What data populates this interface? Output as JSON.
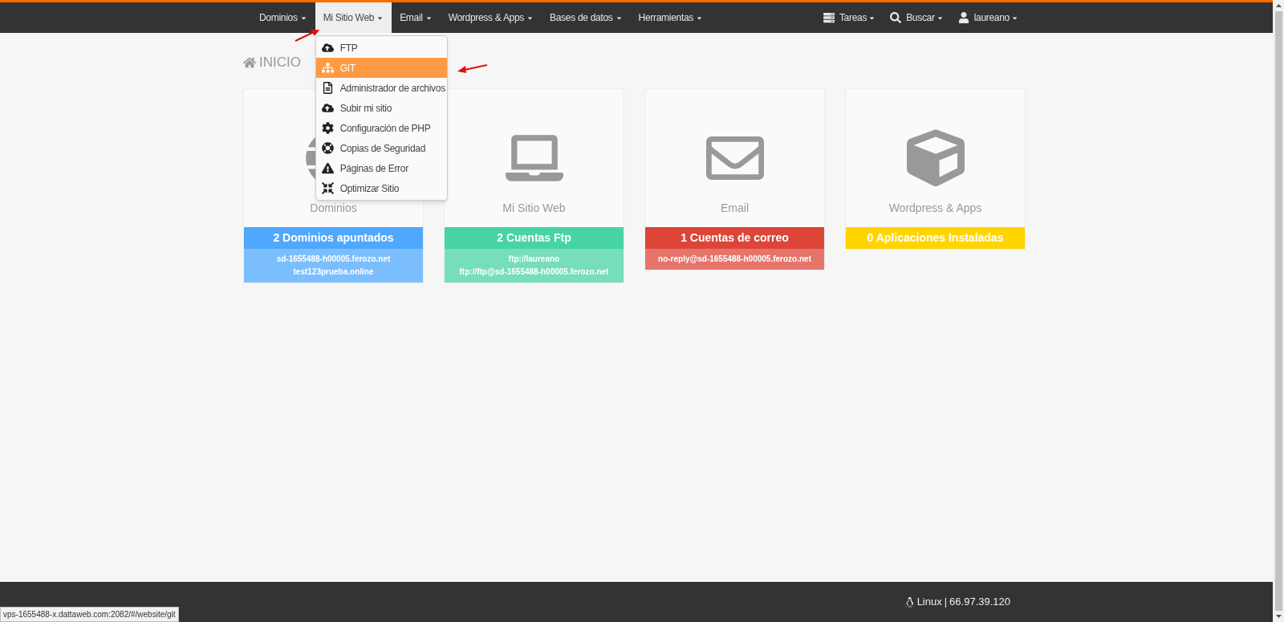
{
  "nav": {
    "items": [
      {
        "label": "Dominios",
        "selected": false
      },
      {
        "label": "Mi Sitio Web",
        "selected": true
      },
      {
        "label": "Email",
        "selected": false
      },
      {
        "label": "Wordpress & Apps",
        "selected": false
      },
      {
        "label": "Bases de datos",
        "selected": false
      },
      {
        "label": "Herramientas",
        "selected": false
      }
    ],
    "right_items": [
      {
        "label": "Tareas",
        "kind": "tasks"
      },
      {
        "label": "Buscar",
        "kind": "search"
      },
      {
        "label": "laureano",
        "kind": "user"
      }
    ]
  },
  "dropdown": [
    {
      "label": "FTP",
      "kind": "cloud",
      "selected": false
    },
    {
      "label": "GIT",
      "kind": "sitemap",
      "selected": true
    },
    {
      "label": "Administrador de archivos",
      "kind": "file",
      "selected": false
    },
    {
      "label": "Subir mi sitio",
      "kind": "cloud",
      "selected": false
    },
    {
      "label": "Configuración de PHP",
      "kind": "gear",
      "selected": false
    },
    {
      "label": "Copias de Seguridad",
      "kind": "lifering",
      "selected": false
    },
    {
      "label": "Páginas de Error",
      "kind": "warning",
      "selected": false
    },
    {
      "label": "Optimizar Sitio",
      "kind": "compress",
      "selected": false
    }
  ],
  "breadcrumb": "INICIO",
  "cards": [
    {
      "title": "Dominios",
      "kind": "globe",
      "header": "2 Dominios apuntados",
      "color": "#4fa8fd",
      "lines": [
        "sd-1655488-h00005.ferozo.net",
        "test123prueba.online"
      ]
    },
    {
      "title": "Mi Sitio Web",
      "kind": "laptop",
      "header": "2 Cuentas Ftp",
      "color": "#48d3a6",
      "lines": [
        "ftp://laureano",
        "ftp://ftp@sd-1655488-h00005.ferozo.net"
      ]
    },
    {
      "title": "Email",
      "kind": "envelope",
      "header": "1 Cuentas de correo",
      "color": "#dc4538",
      "lines": [
        "no-reply@sd-1655488-h00005.ferozo.net"
      ]
    },
    {
      "title": "Wordpress & Apps",
      "kind": "cube",
      "header": "0 Aplicaciones Instaladas",
      "color": "#ffd500"
    }
  ],
  "footer": {
    "os": "Linux",
    "separator": "|",
    "ip": "66.97.39.120"
  },
  "status_url": "vps-1655488-x.dattaweb.com:2082/#/website/git"
}
